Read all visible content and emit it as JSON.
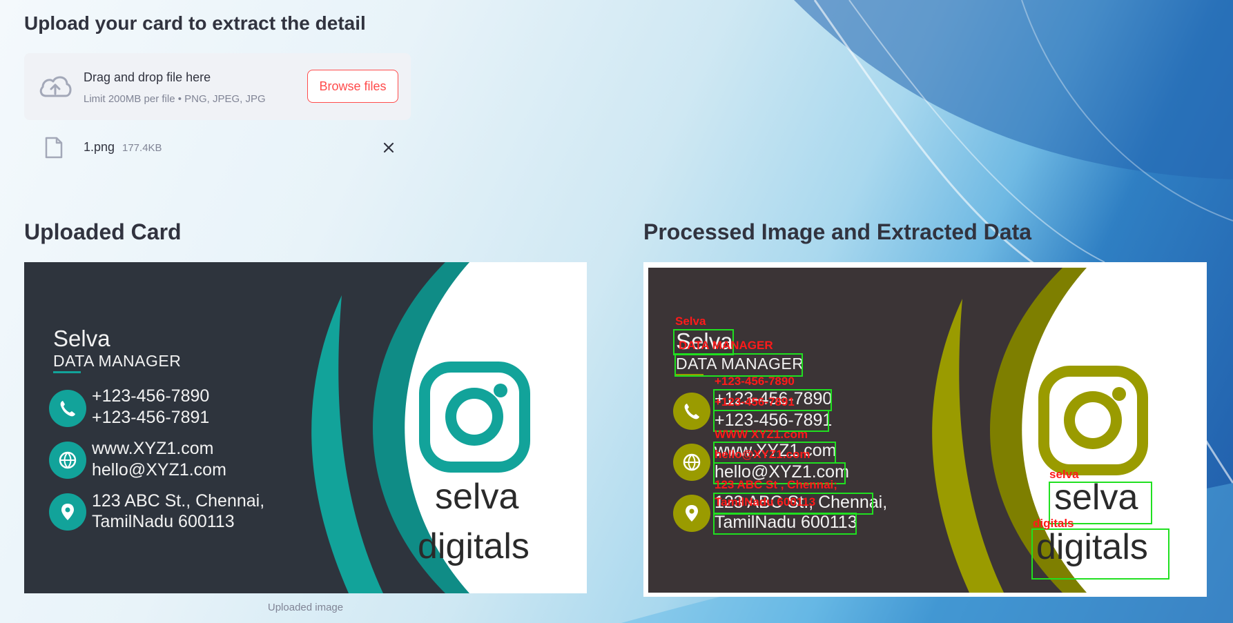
{
  "upload": {
    "heading": "Upload your card to extract the detail",
    "drop_title": "Drag and drop file here",
    "drop_limit": "Limit 200MB per file • PNG, JPEG, JPG",
    "browse_label": "Browse files",
    "file": {
      "name": "1.png",
      "size": "177.4KB"
    },
    "icons": {
      "upload": "cloud-upload-icon",
      "file": "file-icon",
      "remove": "close-icon"
    }
  },
  "uploaded": {
    "heading": "Uploaded Card",
    "caption": "Uploaded image"
  },
  "processed": {
    "heading": "Processed Image and Extracted Data",
    "ocr_labels": {
      "name": "Selva",
      "role": "DATA MANAGER",
      "phone1": "+123-456-7890",
      "phone2": "+123-456-7891",
      "web": "WWW XYZ1.com",
      "email": "hello@XYZ1.com",
      "address": "123 ABC St , Chennai;",
      "address2": "TamilNadu 600113",
      "brand1": "selva",
      "brand2": "digitals"
    }
  },
  "card": {
    "name": "Selva",
    "role": "DATA MANAGER",
    "phone1": "+123-456-7890",
    "phone2": "+123-456-7891",
    "web": "www.XYZ1.com",
    "email": "hello@XYZ1.com",
    "address1": "123 ABC St., Chennai,",
    "address2": "TamilNadu 600113",
    "brand1": "selva",
    "brand2": "digitals",
    "icons": [
      "phone-icon",
      "globe-icon",
      "location-pin-icon",
      "instagram-logo-icon"
    ]
  },
  "colors": {
    "accent": "#ff4b4b",
    "teal": "#12a39a",
    "olive": "#9a9b00",
    "card_dark": "#2e343d",
    "card_proc": "#3b3436",
    "ocr_box": "#20e020",
    "ocr_text": "#ff1a1a"
  }
}
